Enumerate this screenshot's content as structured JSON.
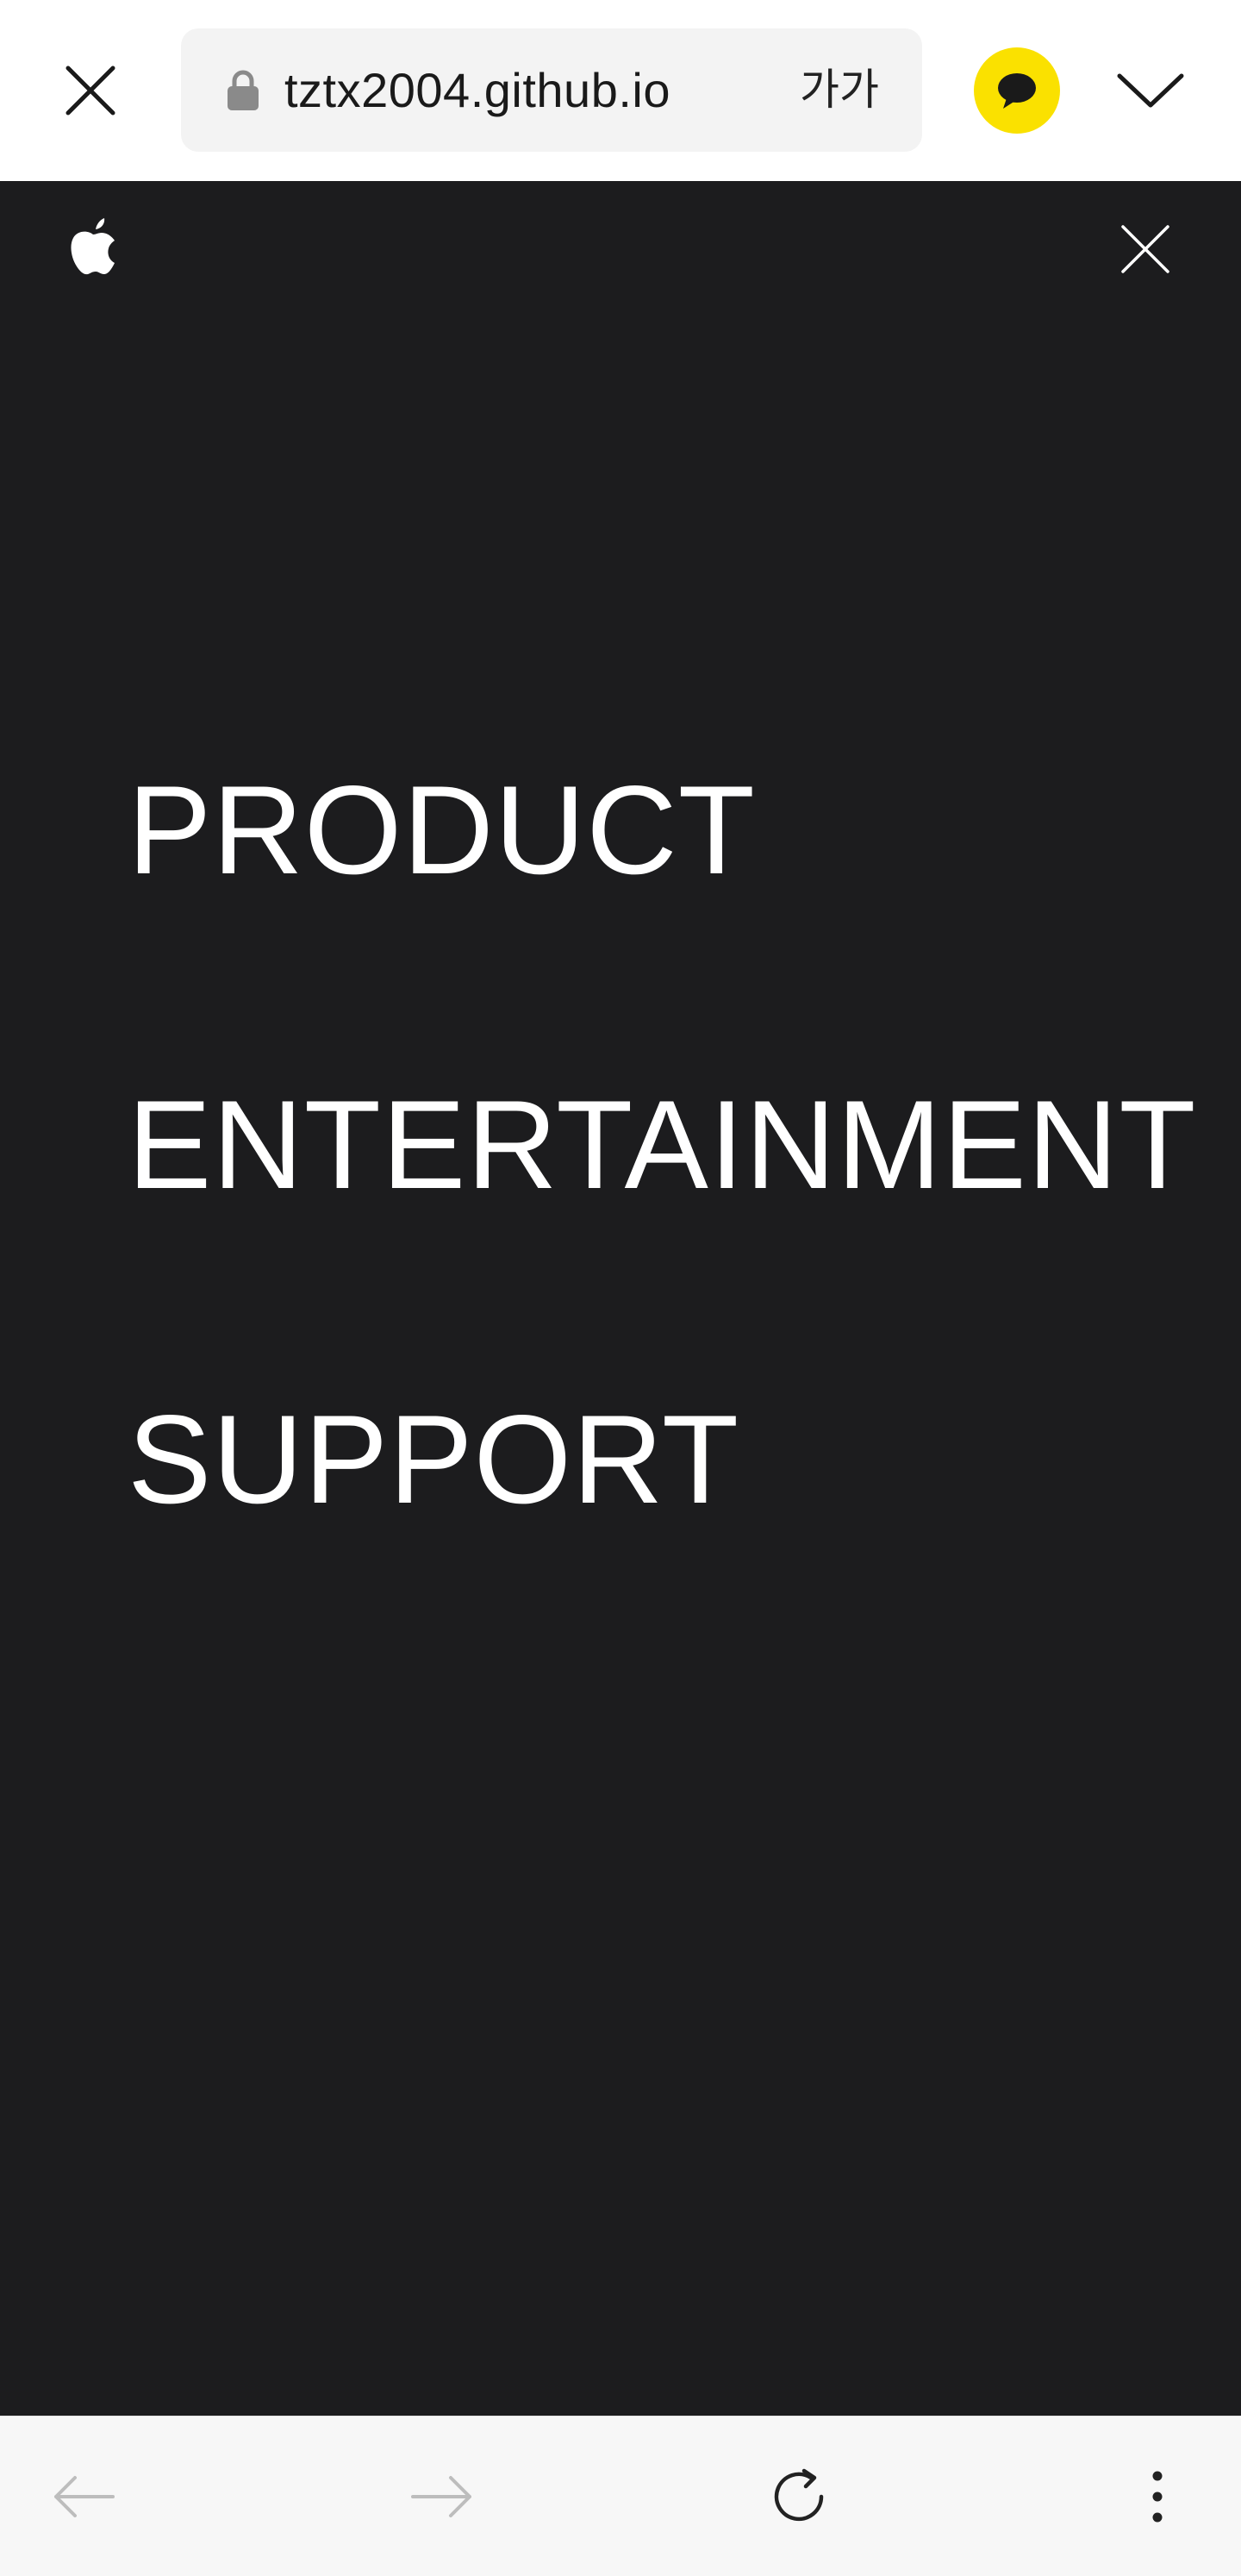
{
  "browser": {
    "url": "tztx2004.github.io",
    "font_size_label": "가가",
    "icons": {
      "close": "close-icon",
      "lock": "lock-icon",
      "kakao": "kakaotalk-chat-icon",
      "collapse": "chevron-down-icon"
    },
    "colors": {
      "toolbar_bg": "#ffffff",
      "url_bg": "#f3f3f3",
      "kakao_yellow": "#fae100"
    }
  },
  "site": {
    "logo": "apple-logo-icon",
    "close_icon": "close-icon",
    "menu": {
      "items": [
        {
          "label": "PRODUCT"
        },
        {
          "label": "ENTERTAINMENT"
        },
        {
          "label": "SUPPORT"
        }
      ]
    },
    "colors": {
      "background": "#1c1c1e",
      "text": "#ffffff"
    }
  },
  "bottom_nav": {
    "icons": [
      "back-arrow-icon",
      "forward-arrow-icon",
      "reload-icon",
      "more-options-icon"
    ],
    "colors": {
      "bar_bg": "#f7f7f7",
      "disabled": "#bdbdbd",
      "enabled": "#222222"
    }
  }
}
